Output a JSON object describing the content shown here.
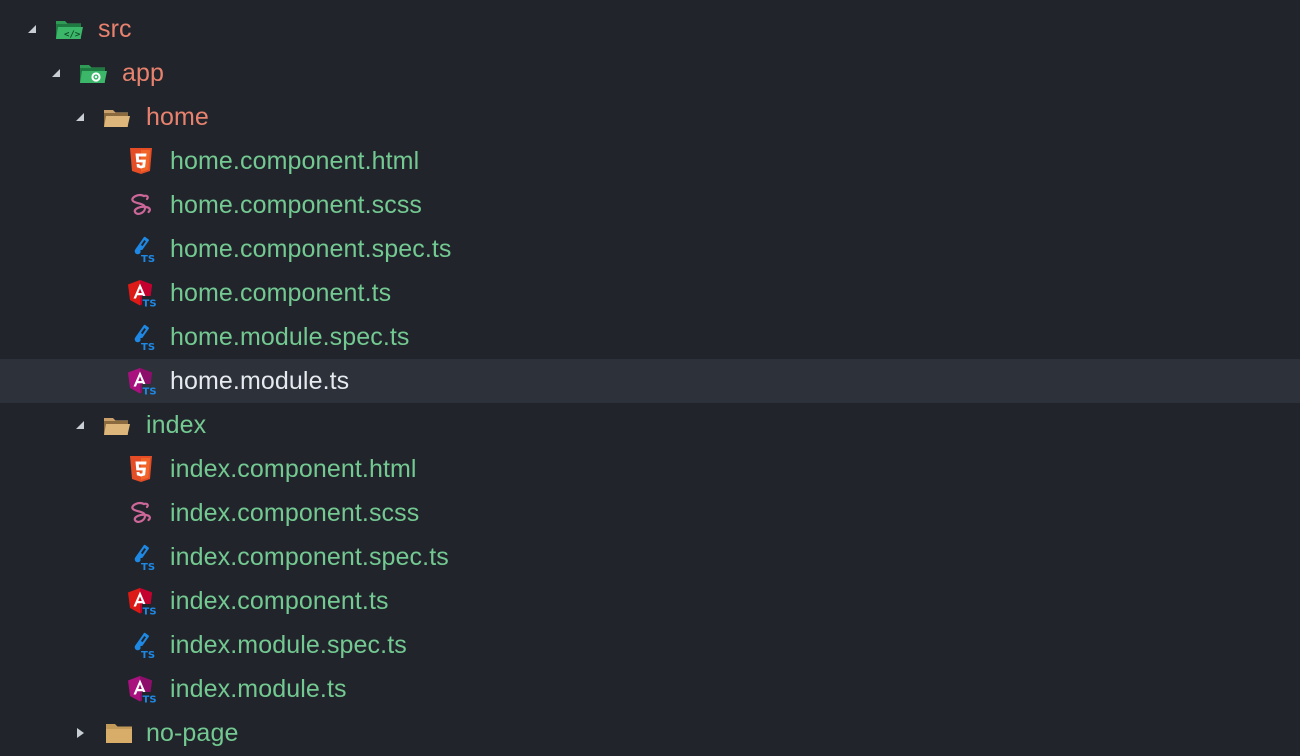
{
  "explorer": {
    "colors": {
      "background": "#21252b",
      "selected_row": "#2c313a",
      "modified_text": "#e8826f",
      "untracked_text": "#73c991",
      "selected_text": "#e6e9ee"
    },
    "tree": {
      "src": {
        "label": "src",
        "expanded": true,
        "icon": "folder-src-open-icon"
      },
      "app": {
        "label": "app",
        "expanded": true,
        "icon": "folder-app-open-icon"
      },
      "home": {
        "label": "home",
        "expanded": true,
        "icon": "folder-open-icon",
        "files": [
          {
            "label": "home.component.html",
            "icon": "html5-icon"
          },
          {
            "label": "home.component.scss",
            "icon": "sass-icon"
          },
          {
            "label": "home.component.spec.ts",
            "icon": "test-ts-icon"
          },
          {
            "label": "home.component.ts",
            "icon": "angular-component-icon"
          },
          {
            "label": "home.module.spec.ts",
            "icon": "test-ts-icon"
          },
          {
            "label": "home.module.ts",
            "icon": "angular-module-icon",
            "selected": true
          }
        ]
      },
      "index": {
        "label": "index",
        "expanded": true,
        "icon": "folder-open-icon",
        "files": [
          {
            "label": "index.component.html",
            "icon": "html5-icon"
          },
          {
            "label": "index.component.scss",
            "icon": "sass-icon"
          },
          {
            "label": "index.component.spec.ts",
            "icon": "test-ts-icon"
          },
          {
            "label": "index.component.ts",
            "icon": "angular-component-icon"
          },
          {
            "label": "index.module.spec.ts",
            "icon": "test-ts-icon"
          },
          {
            "label": "index.module.ts",
            "icon": "angular-module-icon"
          }
        ]
      },
      "no_page": {
        "label": "no-page",
        "expanded": false,
        "icon": "folder-closed-icon"
      }
    }
  }
}
